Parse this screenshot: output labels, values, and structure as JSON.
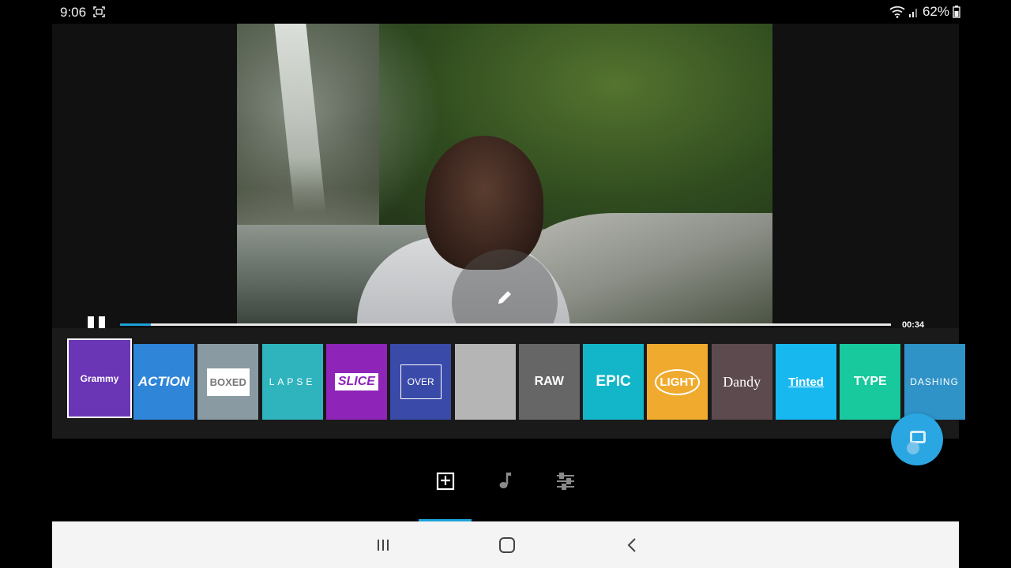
{
  "status_bar": {
    "time": "9:06",
    "battery": "62%",
    "icons": [
      "screenshot-icon",
      "wifi-icon",
      "signal-icon",
      "battery-icon"
    ]
  },
  "player": {
    "elapsed_fraction": 0.04,
    "duration": "00:34",
    "state": "playing",
    "icons": [
      "pause-icon",
      "edit-pencil-icon"
    ]
  },
  "themes": [
    {
      "label": "Grammy",
      "color": "#6a36b6",
      "selected": true
    },
    {
      "label": "ACTION",
      "color": "#2f86d8",
      "selected": false
    },
    {
      "label": "BOXED",
      "color": "#8a9aa3",
      "selected": false
    },
    {
      "label": "LAPSE",
      "color": "#2fb3bd",
      "selected": false
    },
    {
      "label": "SLICE",
      "color": "#8e24b8",
      "selected": false
    },
    {
      "label": "OVER",
      "color": "#3a4aa8",
      "selected": false
    },
    {
      "label": "",
      "color": "#b5b5b5",
      "selected": false
    },
    {
      "label": "RAW",
      "color": "#666666",
      "selected": false
    },
    {
      "label": "EPIC",
      "color": "#13b5c8",
      "selected": false
    },
    {
      "label": "LIGHT",
      "color": "#f0aa2e",
      "selected": false
    },
    {
      "label": "Dandy",
      "color": "#5c4a4f",
      "selected": false
    },
    {
      "label": "Tinted",
      "color": "#16b8ef",
      "selected": false
    },
    {
      "label": "TYPE",
      "color": "#17c99c",
      "selected": false
    },
    {
      "label": "DASHING",
      "color": "#2f93c7",
      "selected": false
    }
  ],
  "bottom_tabs": [
    {
      "name": "themes-tab",
      "icon": "add-theme-icon",
      "active": true
    },
    {
      "name": "music-tab",
      "icon": "music-note-icon",
      "active": false
    },
    {
      "name": "adjust-tab",
      "icon": "sliders-icon",
      "active": false
    }
  ],
  "colors": {
    "accent": "#1da1db",
    "fab": "#2aa6e3"
  }
}
